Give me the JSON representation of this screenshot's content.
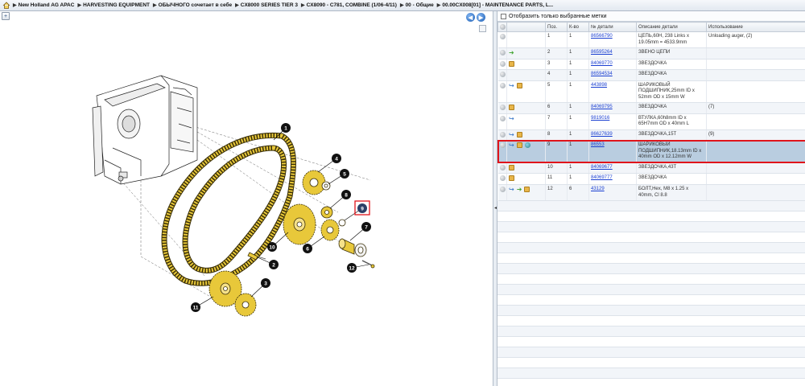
{
  "breadcrumb": [
    "New Holland AG APAC",
    "HARVESTING EQUIPMENT",
    "ОБЫЧНОГО сочетает в себе",
    "CX8000 SERIES TIER 3",
    "CX8090 - C781, COMBINE (1/06-4/11)",
    "00 - Общие",
    "00.00CX008[01] - MAINTENANCE PARTS, L..."
  ],
  "filter": {
    "label": "Отобразить только выбранные метки"
  },
  "table": {
    "headers": [
      "",
      "",
      "Поз.",
      "К-во",
      "№ детали",
      "Описание детали",
      "Использование"
    ],
    "rows": [
      {
        "pos": "1",
        "qty": "1",
        "part": "86566790",
        "desc": "ЦЕПЬ,60Н, 238 Links x 19.05mm = 4533.9mm",
        "usage": "Unloading auger, (2)",
        "icons": [
          "circle"
        ]
      },
      {
        "pos": "2",
        "qty": "1",
        "part": "86595264",
        "desc": "ЗВЕНО ЦЕПИ",
        "usage": "",
        "icons": [
          "circle",
          "arrow-green"
        ]
      },
      {
        "pos": "3",
        "qty": "1",
        "part": "84069770",
        "desc": "ЗВЕЗДОЧКА",
        "usage": "",
        "icons": [
          "circle",
          "box"
        ]
      },
      {
        "pos": "4",
        "qty": "1",
        "part": "86594534",
        "desc": "ЗВЕЗДОЧКА",
        "usage": "",
        "icons": [
          "circle"
        ]
      },
      {
        "pos": "5",
        "qty": "1",
        "part": "443898",
        "desc": "ШАРИКОВЫЙ ПОДШИПНИК,25mm ID x 52mm OD x 15mm W",
        "usage": "",
        "icons": [
          "circle",
          "arrow-blue",
          "box"
        ]
      },
      {
        "pos": "6",
        "qty": "1",
        "part": "84069795",
        "desc": "ЗВЕЗДОЧКА",
        "usage": "(7)",
        "icons": [
          "circle",
          "box"
        ]
      },
      {
        "pos": "7",
        "qty": "1",
        "part": "9819016",
        "desc": "ВТУЛКА,60h8mm ID x 65H7mm OD x 40mm L",
        "usage": "",
        "icons": [
          "circle",
          "arrow-blue"
        ]
      },
      {
        "pos": "8",
        "qty": "1",
        "part": "86627639",
        "desc": "ЗВЕЗДОЧКА,15Т",
        "usage": "(9)",
        "icons": [
          "circle",
          "arrow-blue",
          "box"
        ]
      },
      {
        "pos": "9",
        "qty": "1",
        "part": "86553",
        "desc": "ШАРИКОВЫЙ ПОДШИПНИК,18.13mm ID x 40mm OD x 12.12mm W",
        "usage": "",
        "icons": [
          "circle",
          "arrow-blue",
          "box",
          "globe"
        ],
        "selected": true
      },
      {
        "pos": "10",
        "qty": "1",
        "part": "84069677",
        "desc": "ЗВЕЗДОЧКА,43Т",
        "usage": "",
        "icons": [
          "circle",
          "box"
        ]
      },
      {
        "pos": "11",
        "qty": "1",
        "part": "84069777",
        "desc": "ЗВЕЗДОЧКА",
        "usage": "",
        "icons": [
          "circle",
          "box"
        ]
      },
      {
        "pos": "12",
        "qty": "6",
        "part": "43129",
        "desc": "БОЛТ,Hex, M8 x 1.25 x 40mm, Cl 8.8",
        "usage": "",
        "icons": [
          "circle",
          "arrow-blue",
          "arrow-green",
          "box"
        ]
      }
    ]
  },
  "callouts": [
    "1",
    "2",
    "3",
    "4",
    "5",
    "6",
    "7",
    "8",
    "9",
    "10",
    "11",
    "12"
  ],
  "highlighted_callout": "9",
  "colors": {
    "chain": "#e8c83a",
    "selected_row": "#b9cde0",
    "highlight": "#e0141b",
    "link": "#1a3fd1"
  }
}
